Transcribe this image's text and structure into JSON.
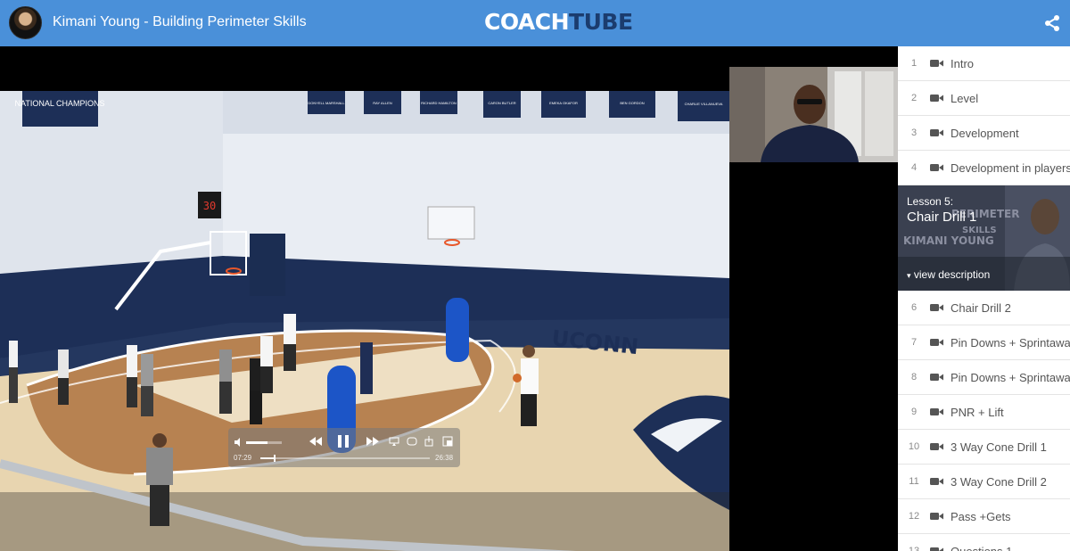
{
  "header": {
    "course_title": "Kimani Young - Building Perimeter Skills",
    "logo_part1": "COACH",
    "logo_part2": "TUBE",
    "share_icon": "share-icon"
  },
  "video": {
    "court_text": "UCONN",
    "banners": [
      "NATIONAL CHAMPIONS",
      "DONYELL MARSHALL",
      "RAY ALLEN",
      "RICHARD HAMILTON",
      "CARON BUTLER",
      "EMEKA OKAFOR",
      "BEN GORDON",
      "CHARLIE VILLANUEVA"
    ],
    "shot_clock": "30",
    "controls": {
      "current_time": "07:29",
      "duration": "26:38",
      "progress": 0.08,
      "volume": 0.6
    }
  },
  "sidebar": {
    "lessons_before": [
      {
        "num": "1",
        "label": "Intro"
      },
      {
        "num": "2",
        "label": "Level"
      },
      {
        "num": "3",
        "label": "Development"
      },
      {
        "num": "4",
        "label": "Development in players"
      }
    ],
    "active": {
      "kicker": "Lesson 5:",
      "name": "Chair Drill 1",
      "view_description": "view description",
      "thumb_text_1": "PERIMETER",
      "thumb_text_2": "SKILLS",
      "thumb_text_3": "KIMANI YOUNG"
    },
    "lessons_after": [
      {
        "num": "6",
        "label": "Chair Drill 2"
      },
      {
        "num": "7",
        "label": "Pin Downs + Sprintaway"
      },
      {
        "num": "8",
        "label": "Pin Downs + Sprintaway"
      },
      {
        "num": "9",
        "label": "PNR + Lift"
      },
      {
        "num": "10",
        "label": "3 Way Cone Drill 1"
      },
      {
        "num": "11",
        "label": "3 Way Cone Drill 2"
      },
      {
        "num": "12",
        "label": "Pass +Gets"
      },
      {
        "num": "13",
        "label": "Questions 1"
      }
    ]
  },
  "colors": {
    "header_blue": "#4a90d9",
    "logo_navy": "#1b3c6e",
    "active_lesson_bg": "#2f3542"
  }
}
